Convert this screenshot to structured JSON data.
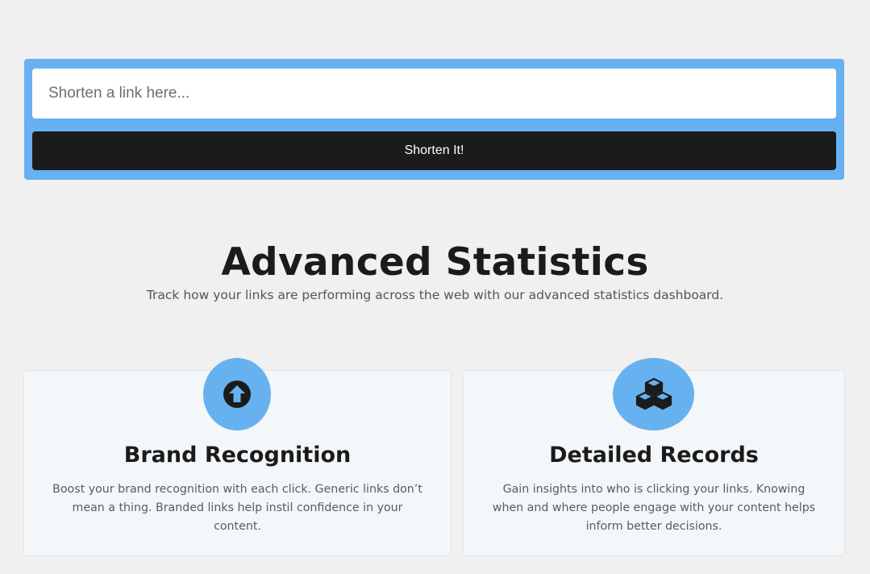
{
  "shortener": {
    "input_placeholder": "Shorten a link here...",
    "input_value": "",
    "button_label": "Shorten It!"
  },
  "section": {
    "title": "Advanced Statistics",
    "subtitle": "Track how your links are performing across the web with our advanced statistics dashboard."
  },
  "cards": [
    {
      "icon": "arrow-up-circle-icon",
      "title": "Brand Recognition",
      "text": "Boost your brand recognition with each click. Generic links don’t mean a thing. Branded links help instil confidence in your content."
    },
    {
      "icon": "cubes-icon",
      "title": "Detailed Records",
      "text": "Gain insights into who is clicking your links. Knowing when and where people engage with your content helps inform better decisions."
    }
  ],
  "colors": {
    "page_background": "#f0f0f0",
    "accent": "#67b1f0",
    "button": "#1b1b1c",
    "card_background": "#f3f7f9",
    "heading": "#1b1b1c",
    "body_text": "#5b5b5b"
  }
}
